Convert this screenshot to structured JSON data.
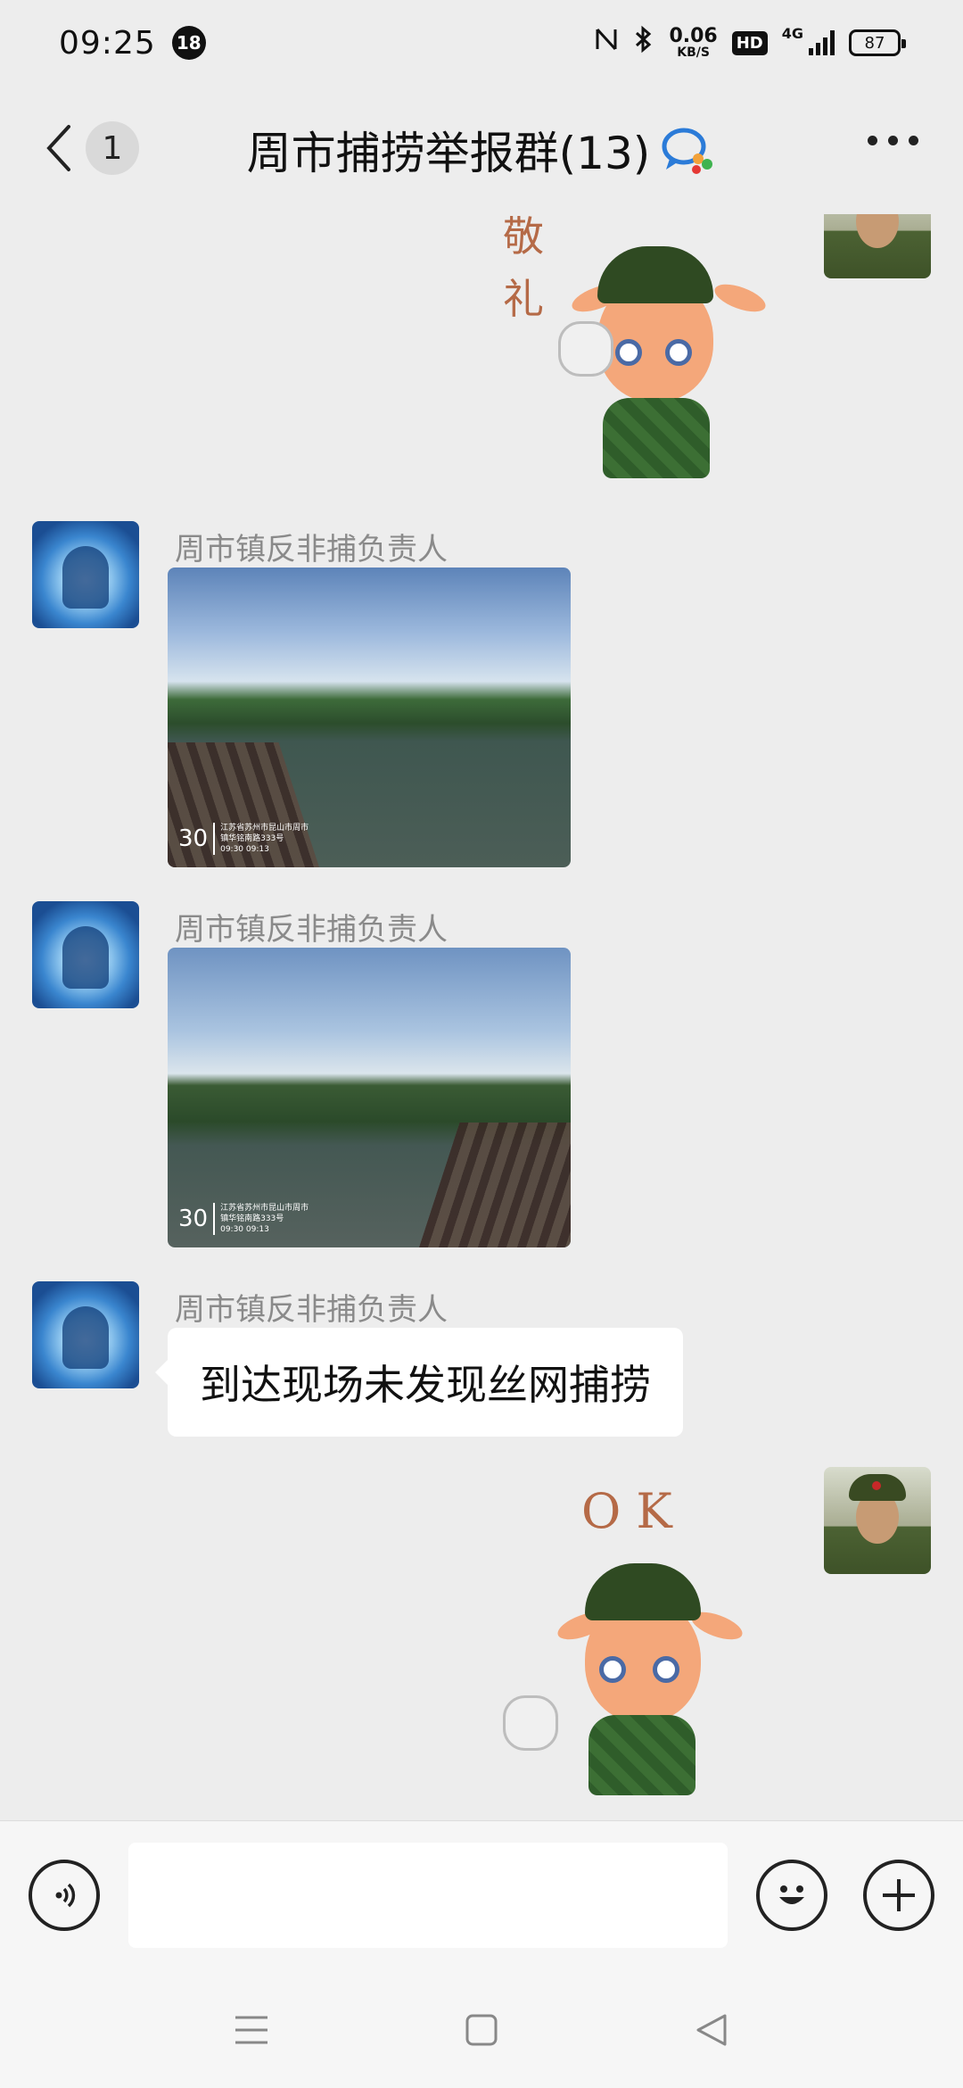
{
  "status_bar": {
    "time": "09:25",
    "notification_count": "18",
    "speed_value": "0.06",
    "speed_unit": "KB/S",
    "hd": "HD",
    "network": "4G",
    "battery": "87"
  },
  "header": {
    "back_count": "1",
    "title": "周市捕捞举报群(13)"
  },
  "messages": [
    {
      "type": "sticker",
      "side": "right",
      "caption": "敬\n礼",
      "sticker": "deer-salute"
    },
    {
      "type": "image",
      "side": "left",
      "sender": "周市镇反非捕负责人",
      "watermark": {
        "number": "30",
        "line1": "江苏省苏州市昆山市周市",
        "line2": "镇华铭南路333号",
        "line3": "09:30 09:13"
      }
    },
    {
      "type": "image",
      "side": "left",
      "sender": "周市镇反非捕负责人",
      "watermark": {
        "number": "30",
        "line1": "江苏省苏州市昆山市周市",
        "line2": "镇华铭南路333号",
        "line3": "09:30 09:13"
      }
    },
    {
      "type": "text",
      "side": "left",
      "sender": "周市镇反非捕负责人",
      "text": "到达现场未发现丝网捕捞"
    },
    {
      "type": "sticker",
      "side": "right",
      "caption": "O K",
      "sticker": "deer-ok"
    }
  ],
  "input": {
    "value": "",
    "placeholder": ""
  },
  "icons": {
    "back": "chevron-left-icon",
    "group": "group-chat-icon",
    "more": "more-dots-icon",
    "voice": "voice-icon",
    "emoji": "emoji-icon",
    "plus": "plus-icon"
  }
}
